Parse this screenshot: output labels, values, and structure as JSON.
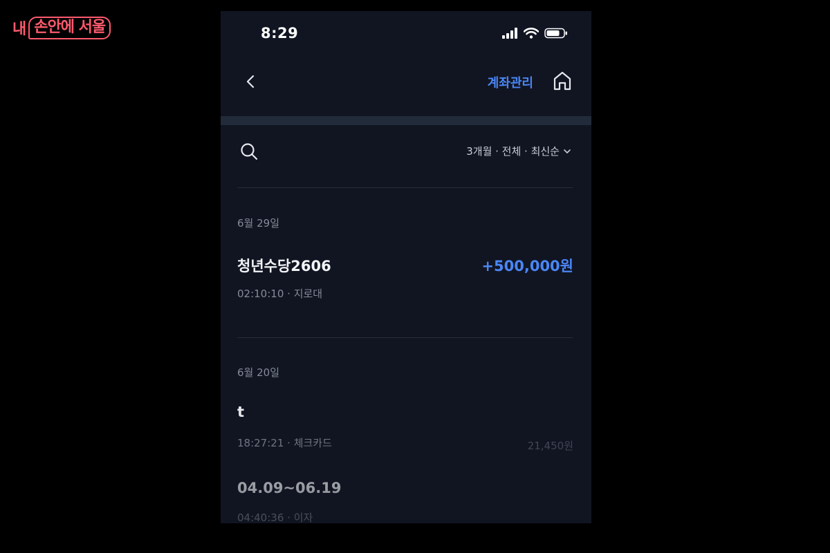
{
  "brand": {
    "part1": "내",
    "part2": "손안에 서울"
  },
  "status_bar": {
    "time": "8:29"
  },
  "header": {
    "account_management": "계좌관리"
  },
  "filter": {
    "label": "3개월 · 전체 · 최신순"
  },
  "groups": [
    {
      "date": "6월 29일",
      "transactions": [
        {
          "title": "청년수당2606",
          "amount": "+500,000원",
          "time": "02:10:10",
          "category": "지로대"
        }
      ]
    },
    {
      "date": "6월 20일",
      "transactions": [
        {
          "title": "t",
          "amount": "21,450원",
          "time": "18:27:21",
          "category": "체크카드"
        },
        {
          "title": "04.09~06.19",
          "amount": "",
          "time": "04:40:36",
          "category": "이자"
        }
      ]
    }
  ],
  "colors": {
    "accent": "#4a86f5",
    "brand": "#ff5a6e",
    "background": "#111522"
  }
}
